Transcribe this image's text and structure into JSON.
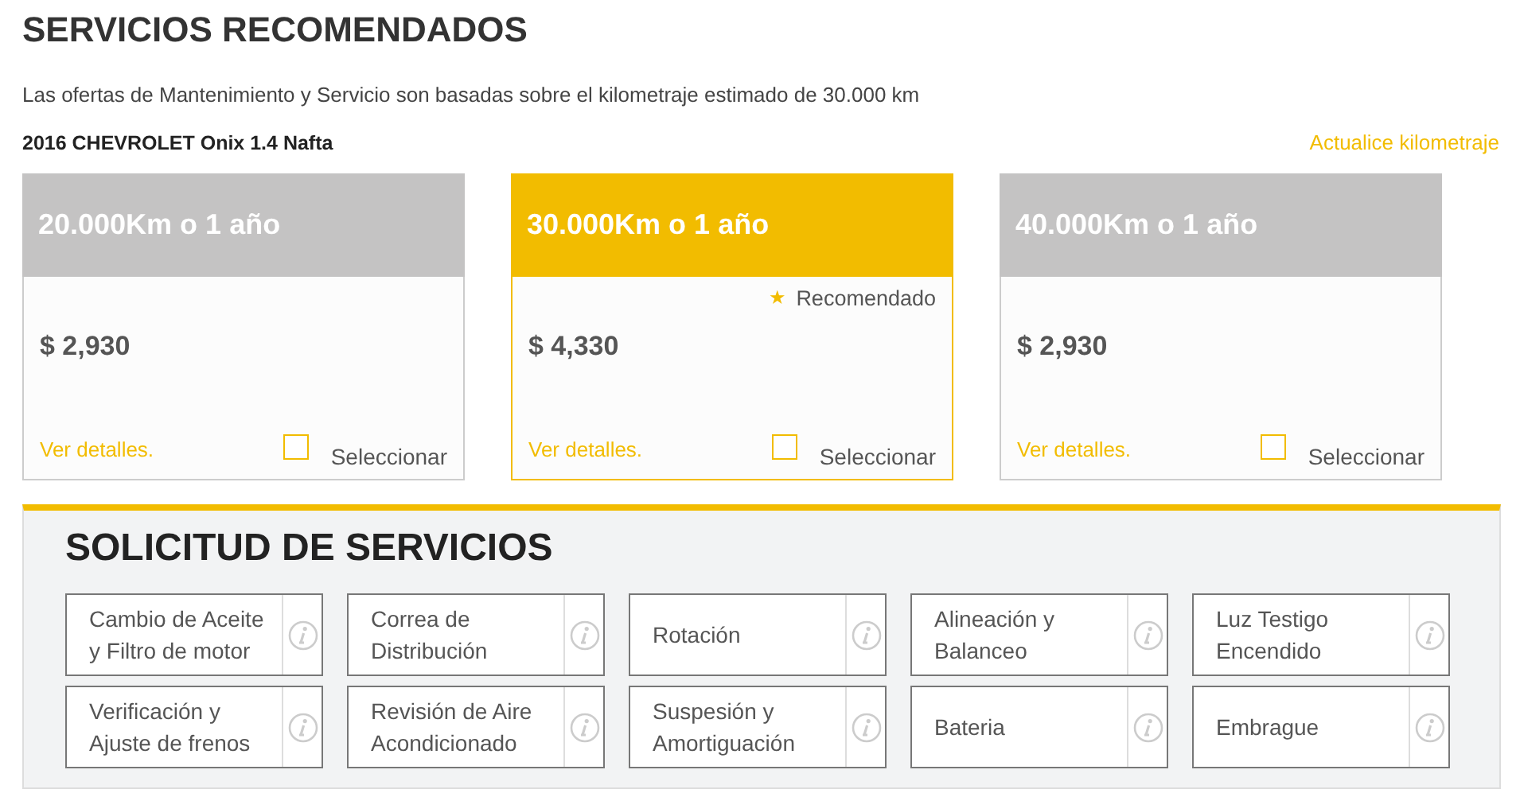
{
  "title": "SERVICIOS RECOMENDADOS",
  "subtitle": "Las ofertas de Mantenimiento y Servicio son basadas sobre el kilometraje estimado de 30.000 km",
  "vehicle": "2016 CHEVROLET Onix 1.4 Nafta",
  "update_link": "Actualice kilometraje",
  "plans": [
    {
      "title": "20.000Km o 1 año",
      "recommended": false,
      "price": "$ 2,930",
      "details_link": "Ver detalles.",
      "select_label": "Seleccionar",
      "checked": false
    },
    {
      "title": "30.000Km o 1 año",
      "recommended": true,
      "badge": "Recomendado",
      "badge_icon": "★",
      "price": "$ 4,330",
      "details_link": "Ver detalles.",
      "select_label": "Seleccionar",
      "checked": false
    },
    {
      "title": "40.000Km o 1 año",
      "recommended": false,
      "price": "$ 2,930",
      "details_link": "Ver detalles.",
      "select_label": "Seleccionar",
      "checked": false
    }
  ],
  "request_section": {
    "title": "SOLICITUD DE SERVICIOS",
    "services": [
      {
        "label": "Cambio de Aceite y Filtro de motor"
      },
      {
        "label": "Correa de Distribución"
      },
      {
        "label": "Rotación"
      },
      {
        "label": "Alineación y Balanceo"
      },
      {
        "label": "Luz Testigo Encendido"
      },
      {
        "label": "Verificación y Ajuste de frenos"
      },
      {
        "label": "Revisión de Aire Acondicionado"
      },
      {
        "label": "Suspesión y Amortiguación"
      },
      {
        "label": "Bateria"
      },
      {
        "label": "Embrague"
      }
    ]
  }
}
